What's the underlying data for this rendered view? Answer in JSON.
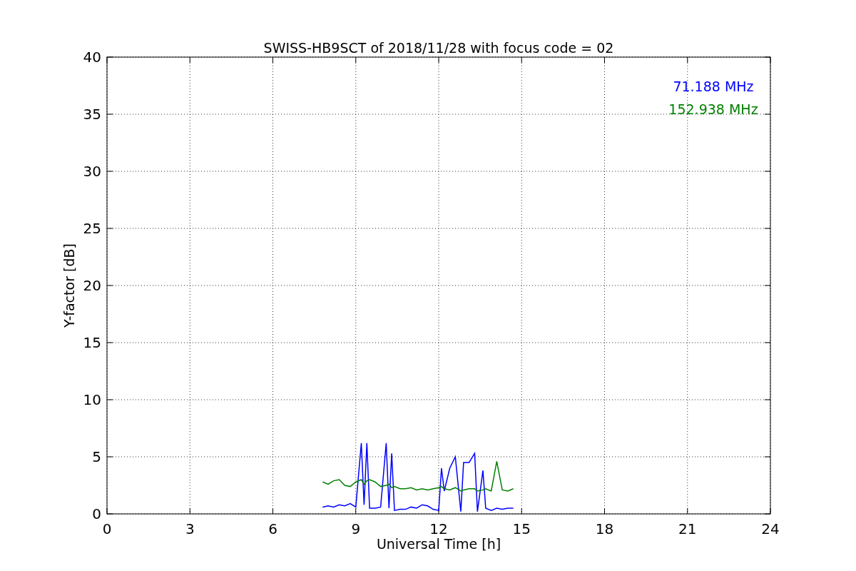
{
  "chart_data": {
    "type": "line",
    "title": "SWISS-HB9SCT of 2018/11/28 with focus code = 02",
    "xlabel": "Universal Time [h]",
    "ylabel": "Y-factor [dB]",
    "x": [
      7.8,
      8.0,
      8.2,
      8.4,
      8.6,
      8.8,
      9.0,
      9.2,
      9.3,
      9.4,
      9.5,
      9.7,
      9.9,
      10.1,
      10.2,
      10.3,
      10.4,
      10.6,
      10.8,
      11.0,
      11.2,
      11.4,
      11.6,
      11.8,
      12.0,
      12.1,
      12.2,
      12.4,
      12.6,
      12.8,
      12.9,
      13.1,
      13.3,
      13.4,
      13.6,
      13.7,
      13.9,
      14.1,
      14.3,
      14.5,
      14.7
    ],
    "series": [
      {
        "name": "71.188 MHz",
        "color": "#0000ff",
        "values": [
          0.6,
          0.7,
          0.6,
          0.8,
          0.7,
          0.9,
          0.6,
          6.2,
          0.8,
          6.2,
          0.5,
          0.5,
          0.6,
          6.2,
          0.5,
          5.3,
          0.3,
          0.4,
          0.4,
          0.6,
          0.5,
          0.8,
          0.7,
          0.4,
          0.3,
          4.0,
          2.0,
          4.0,
          5.0,
          0.2,
          4.5,
          4.5,
          5.3,
          0.2,
          3.8,
          0.5,
          0.3,
          0.5,
          0.4,
          0.5,
          0.5
        ]
      },
      {
        "name": "152.938 MHz",
        "color": "#008000",
        "values": [
          2.8,
          2.6,
          2.9,
          3.0,
          2.5,
          2.4,
          2.8,
          3.0,
          2.6,
          2.9,
          3.0,
          2.8,
          2.4,
          2.5,
          2.6,
          2.3,
          2.4,
          2.2,
          2.2,
          2.3,
          2.1,
          2.2,
          2.1,
          2.2,
          2.3,
          2.4,
          2.2,
          2.1,
          2.3,
          2.0,
          2.1,
          2.2,
          2.2,
          2.0,
          2.1,
          2.2,
          2.0,
          4.6,
          2.1,
          2.0,
          2.2
        ]
      }
    ],
    "xlim": [
      0,
      24
    ],
    "ylim": [
      0,
      40
    ],
    "xticks": [
      0,
      3,
      6,
      9,
      12,
      15,
      18,
      21,
      24
    ],
    "yticks": [
      0,
      5,
      10,
      15,
      20,
      25,
      30,
      35,
      40
    ],
    "grid": true
  }
}
